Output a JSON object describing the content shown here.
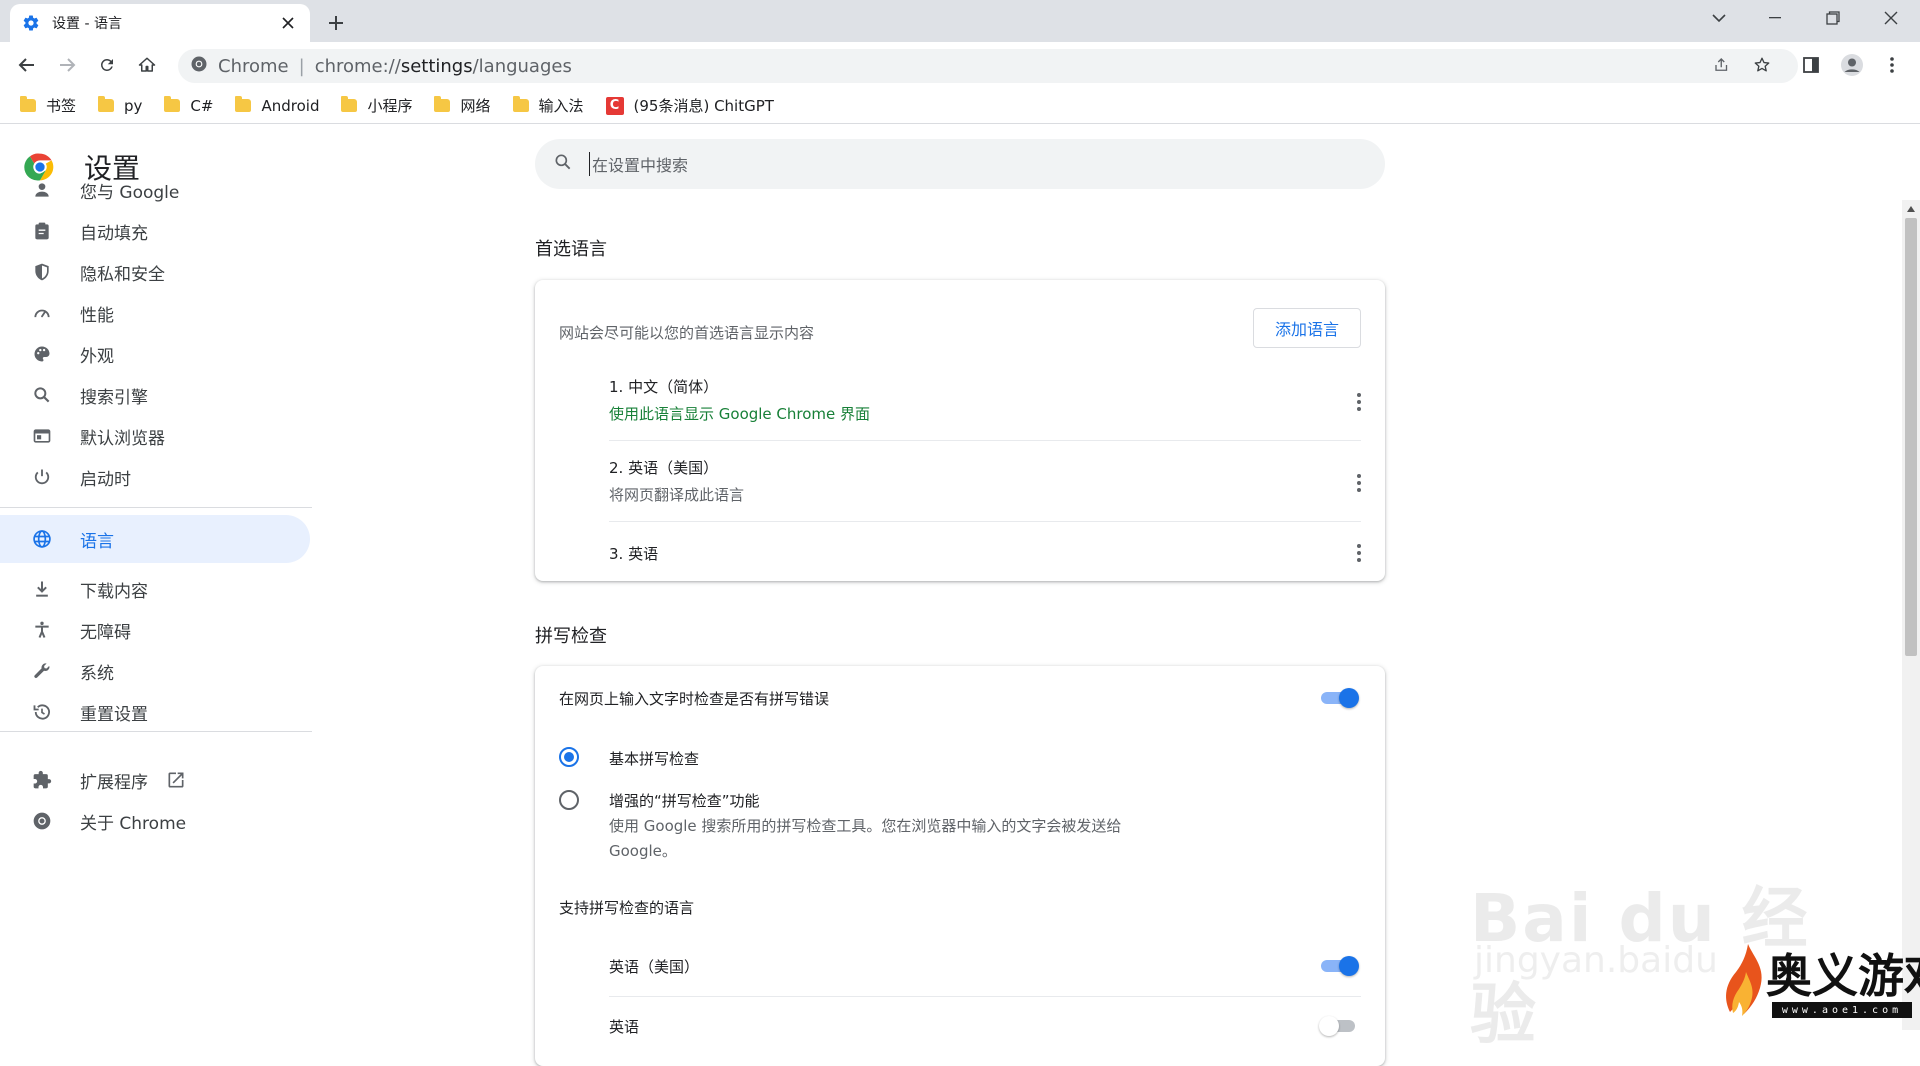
{
  "tab": {
    "title": "设置 - 语言"
  },
  "omnibox": {
    "site": "Chrome",
    "url_prefix": "chrome://",
    "url_path": "settings",
    "url_suffix": "/languages"
  },
  "bookmarks": [
    {
      "label": "书签",
      "type": "folder"
    },
    {
      "label": "py",
      "type": "folder"
    },
    {
      "label": "C#",
      "type": "folder"
    },
    {
      "label": "Android",
      "type": "folder"
    },
    {
      "label": "小程序",
      "type": "folder"
    },
    {
      "label": "网络",
      "type": "folder"
    },
    {
      "label": "输入法",
      "type": "folder"
    },
    {
      "label": "(95条消息) ChitGPT",
      "type": "site",
      "favicon_letter": "C"
    }
  ],
  "sidebar": {
    "brand": "设置",
    "items": [
      {
        "label": "您与 Google",
        "icon": "person-icon"
      },
      {
        "label": "自动填充",
        "icon": "clipboard-icon"
      },
      {
        "label": "隐私和安全",
        "icon": "shield-icon"
      },
      {
        "label": "性能",
        "icon": "speedometer-icon"
      },
      {
        "label": "外观",
        "icon": "palette-icon"
      },
      {
        "label": "搜索引擎",
        "icon": "search-icon"
      },
      {
        "label": "默认浏览器",
        "icon": "browser-icon"
      },
      {
        "label": "启动时",
        "icon": "power-icon"
      },
      {
        "label": "语言",
        "icon": "globe-icon",
        "active": true
      },
      {
        "label": "下载内容",
        "icon": "download-icon"
      },
      {
        "label": "无障碍",
        "icon": "accessibility-icon"
      },
      {
        "label": "系统",
        "icon": "wrench-icon"
      },
      {
        "label": "重置设置",
        "icon": "history-icon"
      },
      {
        "label": "扩展程序",
        "icon": "puzzle-icon"
      },
      {
        "label": "关于 Chrome",
        "icon": "chrome-icon"
      }
    ]
  },
  "search": {
    "placeholder": "在设置中搜索"
  },
  "preferred": {
    "title": "首选语言",
    "description": "网站会尽可能以您的首选语言显示内容",
    "add_button": "添加语言",
    "languages": [
      {
        "name": "1. 中文（简体）",
        "sub": "使用此语言显示 Google Chrome 界面"
      },
      {
        "name": "2. 英语（美国）",
        "sub": "将网页翻译成此语言"
      },
      {
        "name": "3. 英语",
        "sub": ""
      }
    ]
  },
  "spellcheck": {
    "title": "拼写检查",
    "toggle_label": "在网页上输入文字时检查是否有拼写错误",
    "toggle_on": true,
    "basic_label": "基本拼写检查",
    "enhanced_label": "增强的“拼写检查”功能",
    "enhanced_desc_1": "使用 Google 搜索所用的拼写检查工具。您在浏览器中输入的文字会被发送给",
    "enhanced_desc_2": "Google。",
    "selected": "basic",
    "languages_title": "支持拼写检查的语言",
    "languages": [
      {
        "name": "英语（美国）",
        "enabled": true
      },
      {
        "name": "英语",
        "enabled": false
      }
    ]
  },
  "watermarks": {
    "baidu": "Bai du 经验",
    "baidu_sub": "jingyan.baidu",
    "aoe": "奥义游戏网",
    "aoe_url": "www.aoe1.com"
  }
}
